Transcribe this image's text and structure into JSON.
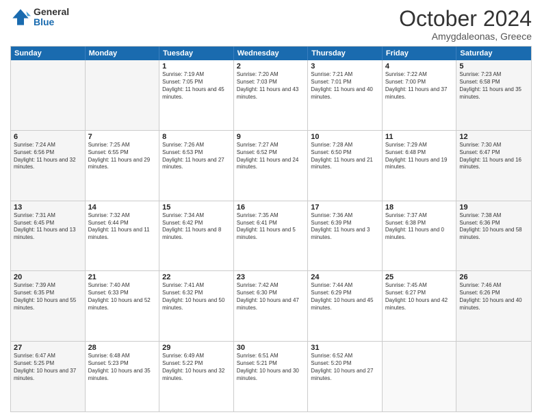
{
  "header": {
    "logo_general": "General",
    "logo_blue": "Blue",
    "month": "October 2024",
    "location": "Amygdaleonas, Greece"
  },
  "calendar": {
    "weekdays": [
      "Sunday",
      "Monday",
      "Tuesday",
      "Wednesday",
      "Thursday",
      "Friday",
      "Saturday"
    ],
    "rows": [
      [
        {
          "day": "",
          "info": "",
          "shade": true
        },
        {
          "day": "",
          "info": "",
          "shade": true
        },
        {
          "day": "1",
          "info": "Sunrise: 7:19 AM\nSunset: 7:05 PM\nDaylight: 11 hours and 45 minutes.",
          "shade": false
        },
        {
          "day": "2",
          "info": "Sunrise: 7:20 AM\nSunset: 7:03 PM\nDaylight: 11 hours and 43 minutes.",
          "shade": false
        },
        {
          "day": "3",
          "info": "Sunrise: 7:21 AM\nSunset: 7:01 PM\nDaylight: 11 hours and 40 minutes.",
          "shade": false
        },
        {
          "day": "4",
          "info": "Sunrise: 7:22 AM\nSunset: 7:00 PM\nDaylight: 11 hours and 37 minutes.",
          "shade": false
        },
        {
          "day": "5",
          "info": "Sunrise: 7:23 AM\nSunset: 6:58 PM\nDaylight: 11 hours and 35 minutes.",
          "shade": true
        }
      ],
      [
        {
          "day": "6",
          "info": "Sunrise: 7:24 AM\nSunset: 6:56 PM\nDaylight: 11 hours and 32 minutes.",
          "shade": true
        },
        {
          "day": "7",
          "info": "Sunrise: 7:25 AM\nSunset: 6:55 PM\nDaylight: 11 hours and 29 minutes.",
          "shade": false
        },
        {
          "day": "8",
          "info": "Sunrise: 7:26 AM\nSunset: 6:53 PM\nDaylight: 11 hours and 27 minutes.",
          "shade": false
        },
        {
          "day": "9",
          "info": "Sunrise: 7:27 AM\nSunset: 6:52 PM\nDaylight: 11 hours and 24 minutes.",
          "shade": false
        },
        {
          "day": "10",
          "info": "Sunrise: 7:28 AM\nSunset: 6:50 PM\nDaylight: 11 hours and 21 minutes.",
          "shade": false
        },
        {
          "day": "11",
          "info": "Sunrise: 7:29 AM\nSunset: 6:48 PM\nDaylight: 11 hours and 19 minutes.",
          "shade": false
        },
        {
          "day": "12",
          "info": "Sunrise: 7:30 AM\nSunset: 6:47 PM\nDaylight: 11 hours and 16 minutes.",
          "shade": true
        }
      ],
      [
        {
          "day": "13",
          "info": "Sunrise: 7:31 AM\nSunset: 6:45 PM\nDaylight: 11 hours and 13 minutes.",
          "shade": true
        },
        {
          "day": "14",
          "info": "Sunrise: 7:32 AM\nSunset: 6:44 PM\nDaylight: 11 hours and 11 minutes.",
          "shade": false
        },
        {
          "day": "15",
          "info": "Sunrise: 7:34 AM\nSunset: 6:42 PM\nDaylight: 11 hours and 8 minutes.",
          "shade": false
        },
        {
          "day": "16",
          "info": "Sunrise: 7:35 AM\nSunset: 6:41 PM\nDaylight: 11 hours and 5 minutes.",
          "shade": false
        },
        {
          "day": "17",
          "info": "Sunrise: 7:36 AM\nSunset: 6:39 PM\nDaylight: 11 hours and 3 minutes.",
          "shade": false
        },
        {
          "day": "18",
          "info": "Sunrise: 7:37 AM\nSunset: 6:38 PM\nDaylight: 11 hours and 0 minutes.",
          "shade": false
        },
        {
          "day": "19",
          "info": "Sunrise: 7:38 AM\nSunset: 6:36 PM\nDaylight: 10 hours and 58 minutes.",
          "shade": true
        }
      ],
      [
        {
          "day": "20",
          "info": "Sunrise: 7:39 AM\nSunset: 6:35 PM\nDaylight: 10 hours and 55 minutes.",
          "shade": true
        },
        {
          "day": "21",
          "info": "Sunrise: 7:40 AM\nSunset: 6:33 PM\nDaylight: 10 hours and 52 minutes.",
          "shade": false
        },
        {
          "day": "22",
          "info": "Sunrise: 7:41 AM\nSunset: 6:32 PM\nDaylight: 10 hours and 50 minutes.",
          "shade": false
        },
        {
          "day": "23",
          "info": "Sunrise: 7:42 AM\nSunset: 6:30 PM\nDaylight: 10 hours and 47 minutes.",
          "shade": false
        },
        {
          "day": "24",
          "info": "Sunrise: 7:44 AM\nSunset: 6:29 PM\nDaylight: 10 hours and 45 minutes.",
          "shade": false
        },
        {
          "day": "25",
          "info": "Sunrise: 7:45 AM\nSunset: 6:27 PM\nDaylight: 10 hours and 42 minutes.",
          "shade": false
        },
        {
          "day": "26",
          "info": "Sunrise: 7:46 AM\nSunset: 6:26 PM\nDaylight: 10 hours and 40 minutes.",
          "shade": true
        }
      ],
      [
        {
          "day": "27",
          "info": "Sunrise: 6:47 AM\nSunset: 5:25 PM\nDaylight: 10 hours and 37 minutes.",
          "shade": true
        },
        {
          "day": "28",
          "info": "Sunrise: 6:48 AM\nSunset: 5:23 PM\nDaylight: 10 hours and 35 minutes.",
          "shade": false
        },
        {
          "day": "29",
          "info": "Sunrise: 6:49 AM\nSunset: 5:22 PM\nDaylight: 10 hours and 32 minutes.",
          "shade": false
        },
        {
          "day": "30",
          "info": "Sunrise: 6:51 AM\nSunset: 5:21 PM\nDaylight: 10 hours and 30 minutes.",
          "shade": false
        },
        {
          "day": "31",
          "info": "Sunrise: 6:52 AM\nSunset: 5:20 PM\nDaylight: 10 hours and 27 minutes.",
          "shade": false
        },
        {
          "day": "",
          "info": "",
          "shade": false
        },
        {
          "day": "",
          "info": "",
          "shade": true
        }
      ]
    ]
  }
}
